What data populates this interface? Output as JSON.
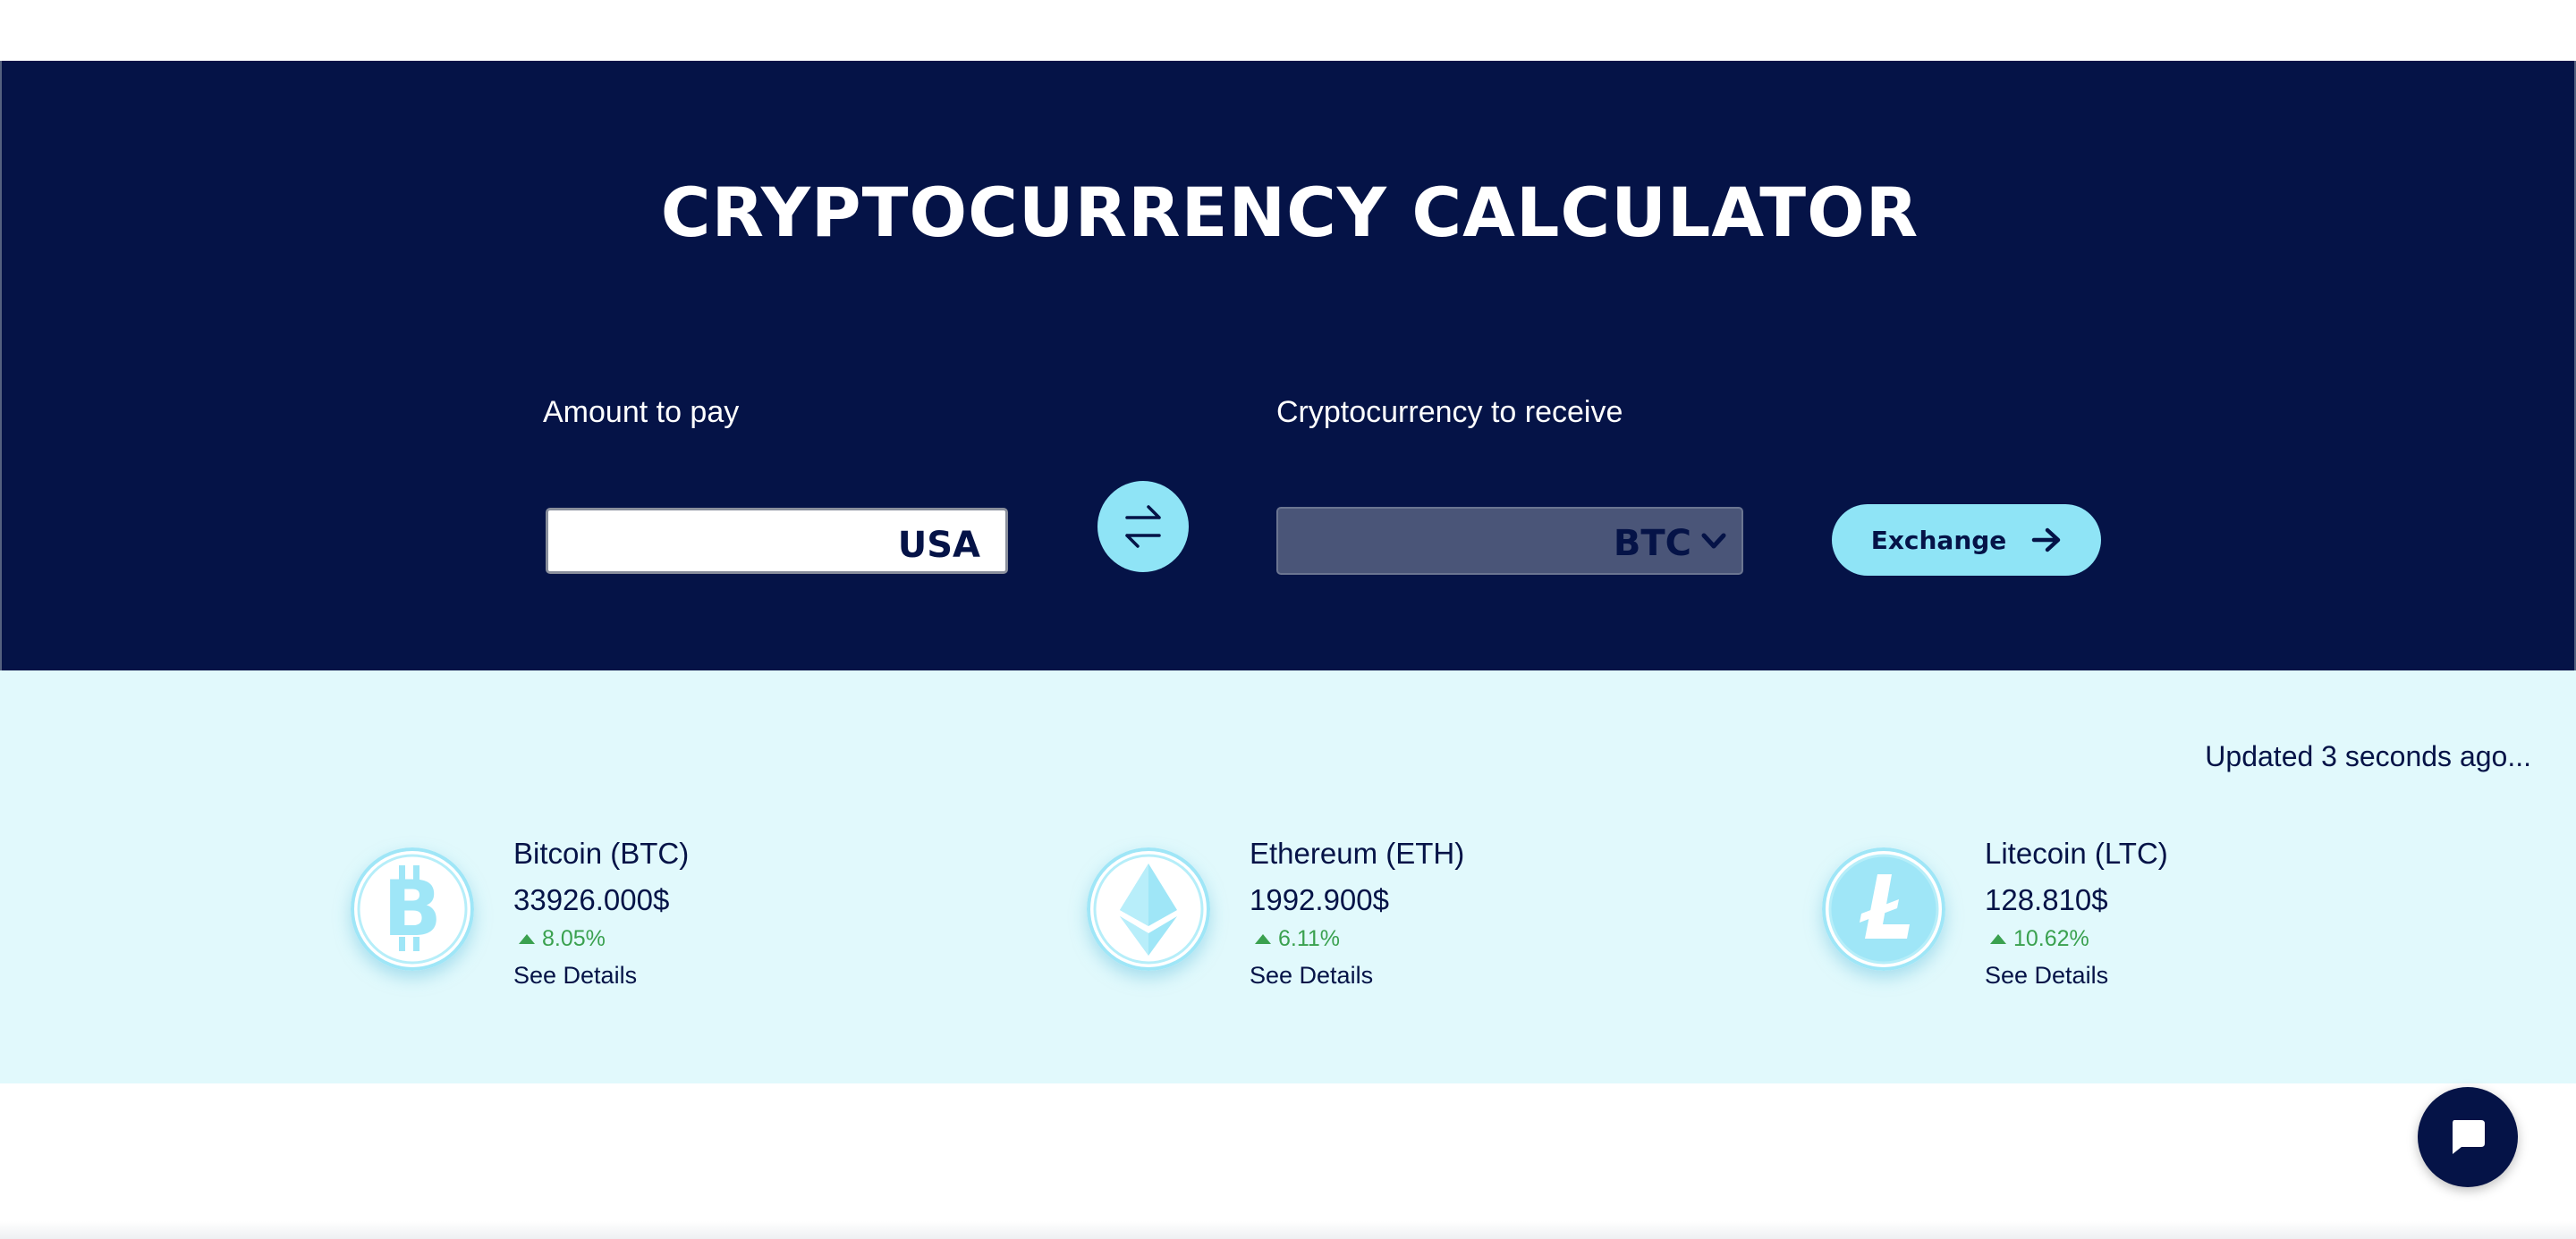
{
  "hero": {
    "title": "CRYPTOCURRENCY CALCULATOR",
    "amount_label": "Amount to pay",
    "amount_value": "",
    "amount_currency": "USA",
    "crypto_label": "Cryptocurrency to receive",
    "crypto_selected": "BTC",
    "exchange_label": "Exchange",
    "colors": {
      "background": "#051347",
      "accent": "#8fe4f6"
    }
  },
  "rates": {
    "updated_text": "Updated 3 seconds ago...",
    "coins": [
      {
        "name": "Bitcoin (BTC)",
        "price": "33926.000$",
        "change": "8.05%",
        "details": "See Details",
        "icon": "bitcoin-icon"
      },
      {
        "name": "Ethereum (ETH)",
        "price": "1992.900$",
        "change": "6.11%",
        "details": "See Details",
        "icon": "ethereum-icon"
      },
      {
        "name": "Litecoin (LTC)",
        "price": "128.810$",
        "change": "10.62%",
        "details": "See Details",
        "icon": "litecoin-icon"
      }
    ],
    "colors": {
      "background": "#e1f9fc",
      "positive": "#3aa14f"
    }
  },
  "chat": {
    "icon": "chat-bubble-icon"
  }
}
